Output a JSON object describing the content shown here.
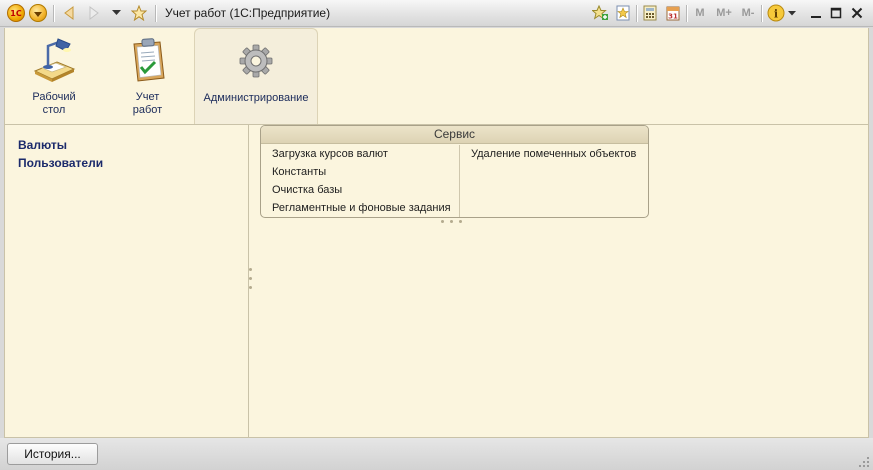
{
  "window": {
    "title": "Учет работ  (1С:Предприятие)"
  },
  "toolbar": {
    "logo": "1С",
    "memory_buttons": [
      "M",
      "M+",
      "M-"
    ],
    "icons": [
      "menu-icon",
      "back-icon",
      "forward-icon",
      "history-dropdown-icon",
      "favorites-star-icon",
      "add-to-favorites-icon",
      "favorites-list-icon",
      "calculator-icon",
      "calendar-icon",
      "info-icon",
      "minimize-icon",
      "maximize-icon",
      "close-icon"
    ]
  },
  "sections": [
    {
      "label": "Рабочий\nстол",
      "line1": "Рабочий",
      "line2": "стол",
      "icon": "desk-lamp-icon"
    },
    {
      "label": "Учет\nработ",
      "line1": "Учет",
      "line2": "работ",
      "icon": "clipboard-icon"
    },
    {
      "label": "Администрирование",
      "line1": "Администрирование",
      "line2": "",
      "icon": "gear-icon",
      "active": true
    }
  ],
  "nav_panel": {
    "items": [
      "Валюты",
      "Пользователи"
    ]
  },
  "service_group": {
    "title": "Сервис",
    "column1": [
      "Загрузка курсов валют",
      "Константы",
      "Очистка базы",
      "Регламентные и фоновые задания"
    ],
    "column2": [
      "Удаление помеченных объектов"
    ]
  },
  "statusbar": {
    "history_label": "История..."
  },
  "colors": {
    "panel_bg": "#fbf5de",
    "link_color": "#1b2a6b",
    "frame": "#d9d9d9"
  }
}
